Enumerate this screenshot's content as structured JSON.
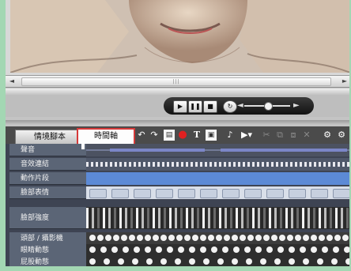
{
  "colors": {
    "timeline_bg": "#3e4453",
    "label_bg": "#5b6576",
    "track_blue": "#5c8ad6",
    "tab_highlight": "#d63a3a",
    "frame_green": "#a3d7b3"
  },
  "preview": {
    "subject": "portrait-sketch"
  },
  "scrollbar": {
    "grip": "|||"
  },
  "player": {
    "play_icon": "▶",
    "pause_icon": "❚❚",
    "stop_icon": "■",
    "loop_icon": "↻",
    "volume_low_icon": "◄",
    "volume_high_icon": "►",
    "volume_level": 0.5
  },
  "tabs": {
    "script": "情境腳本",
    "timeline": "時間軸"
  },
  "toolbar": {
    "undo": "↶",
    "redo": "↷",
    "new_doc": "▤",
    "record": "●",
    "text": "T",
    "image": "▣",
    "music": "♪",
    "flag": "▶▾",
    "cut": "✂",
    "copy": "⧉",
    "paste": "⧈",
    "delete": "✕",
    "more": "⚙"
  },
  "timeline_rows": [
    {
      "label": "聲音"
    },
    {
      "label": "音效連結"
    },
    {
      "label": "動作片段"
    },
    {
      "label": "臉部表情"
    },
    {
      "label": "臉部強度"
    },
    {
      "label": "頭部 / 攝影機"
    },
    {
      "label": "眼睛動態"
    },
    {
      "label": "屁股動態"
    }
  ]
}
